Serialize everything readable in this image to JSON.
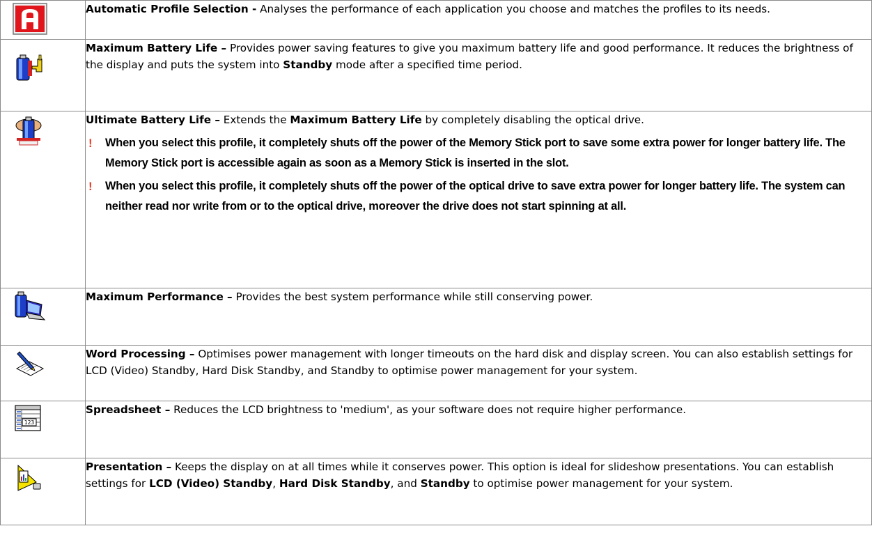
{
  "profiles": [
    {
      "icon": "letter-a-icon",
      "term": "Automatic Profile Selection -",
      "desc": " Analyses the performance of each application you choose and matches the profiles to its needs."
    },
    {
      "icon": "battery-plug-icon",
      "term": "Maximum Battery Life –",
      "desc_parts": [
        " Provides power saving features to give you maximum battery life and good performance. It reduces the brightness of the display and puts the system into ",
        "Standby",
        " mode after a specified time period."
      ]
    },
    {
      "icon": "battery-guard-icon",
      "term": "Ultimate Battery Life –",
      "desc_parts": [
        " Extends the ",
        "Maximum Battery Life",
        " by completely disabling the optical drive."
      ],
      "notes": [
        "When you select this profile, it completely shuts off the power of the Memory Stick port to save some extra power for longer battery life. The Memory Stick port is accessible again as soon as a Memory Stick is inserted in the slot.",
        "When you select this profile, it completely shuts off the power of the optical drive to save extra power for longer battery life. The system can neither read nor write from or to the optical drive, moreover the drive does not start spinning at all."
      ],
      "note_mark": "!"
    },
    {
      "icon": "battery-laptop-icon",
      "term": "Maximum Performance –",
      "desc": " Provides the best system performance while still conserving power."
    },
    {
      "icon": "pen-paper-icon",
      "term": "Word Processing –",
      "desc": " Optimises power management with longer timeouts on the hard disk and display screen. You can also establish settings for LCD (Video) Standby, Hard Disk Standby, and Standby to optimise power management for your system."
    },
    {
      "icon": "spreadsheet-icon",
      "term": "Spreadsheet –",
      "desc": " Reduces the LCD brightness to 'medium', as your software does not require higher performance.",
      "icon_text": "123"
    },
    {
      "icon": "presentation-icon",
      "term": "Presentation –",
      "desc_parts": [
        " Keeps the display on at all times while it conserves power. This option is ideal for slideshow presentations. You can establish settings for ",
        "LCD (Video) Standby",
        ", ",
        "Hard Disk Standby",
        ", and ",
        "Standby",
        " to optimise power management for your system."
      ]
    }
  ]
}
